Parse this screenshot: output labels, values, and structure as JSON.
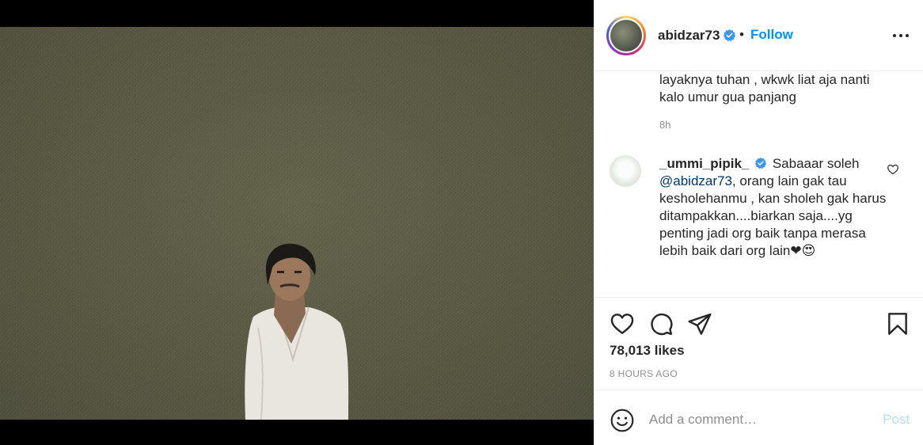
{
  "post": {
    "author": "abidzar73",
    "follow_label": "Follow",
    "separator": "•",
    "photo_alt": "Man in a white shirt against a dark olive background"
  },
  "comments": {
    "continuation_text": "layaknya tuhan , wkwk liat aja nanti kalo umur gua panjang",
    "continuation_time": "8h",
    "second": {
      "username": "_ummi_pipik_",
      "text_lead": "Sabaaar soleh",
      "mention": "@abidzar73",
      "text_body": ", orang lain gak tau kesholehanmu , kan sholeh gak harus ditampakkan....biarkan saja....yg penting jadi org baik tanpa merasa lebih baik dari org lain",
      "emojis": "❤😍"
    }
  },
  "actions": {
    "likes": "78,013 likes",
    "time_ago": "8 HOURS AGO"
  },
  "add_comment": {
    "placeholder": "Add a comment…",
    "post_label": "Post"
  },
  "icons": [
    "verified-badge-icon",
    "more-options-icon",
    "like-icon",
    "comment-icon",
    "share-icon",
    "save-icon",
    "emoji-icon",
    "small-heart-icon"
  ],
  "colors": {
    "accent": "#0095f6",
    "text": "#262626",
    "muted": "#8e8e8e",
    "post_disabled": "#b2dffc"
  }
}
